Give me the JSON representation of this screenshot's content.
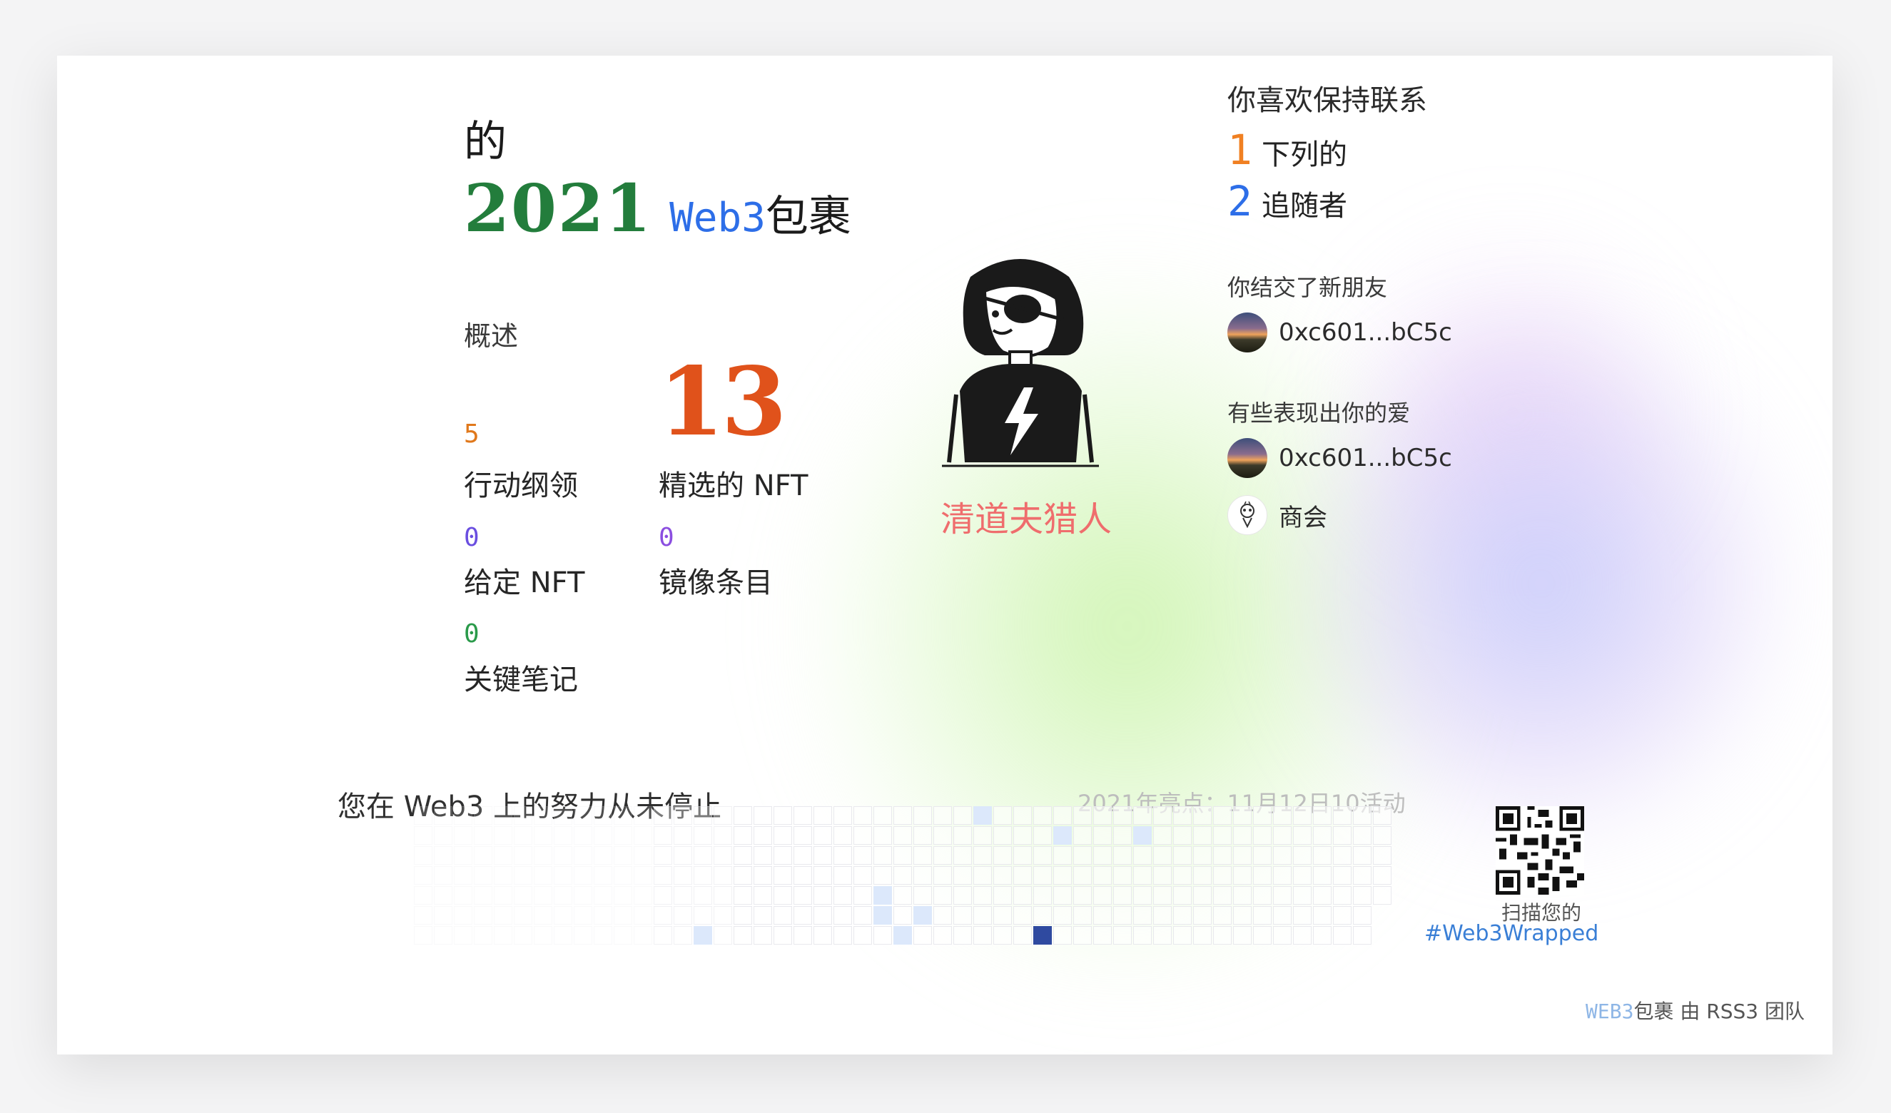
{
  "header": {
    "title_prefix": "的",
    "year": "2021",
    "web3": "Web3",
    "wrapped": "包裹"
  },
  "overview": {
    "label": "概述",
    "featured": {
      "value": "13",
      "label": "精选的 NFT",
      "color": "#e0521b"
    },
    "stats": [
      {
        "value": "5",
        "label": "行动纲领",
        "color": "#e0781b"
      },
      {
        "value": "0",
        "label": "给定 NFT",
        "color": "#6a4ee0"
      },
      {
        "value": "0",
        "label": "镜像条目",
        "color": "#8b4ee0"
      },
      {
        "value": "0",
        "label": "关键笔记",
        "color": "#2a9a4a"
      }
    ]
  },
  "profile": {
    "name": "清道夫猎人",
    "avatar_icon": "eyepatch-girl-avatar"
  },
  "connections": {
    "title": "你喜欢保持联系",
    "following": {
      "value": "1",
      "label": "下列的",
      "color": "#f08022"
    },
    "followers": {
      "value": "2",
      "label": "追随者",
      "color": "#2d6ee8"
    },
    "new_friends_label": "你结交了新朋友",
    "new_friends": [
      {
        "name": "0xc601...bC5c",
        "avatar": "sunset"
      }
    ],
    "loved_label": "有些表现出你的爱",
    "loved": [
      {
        "name": "0xc601...bC5c",
        "avatar": "sunset"
      },
      {
        "name": "商会",
        "avatar": "chamber"
      }
    ]
  },
  "activity": {
    "headline": "您在 Web3 上的努力从未停止",
    "highlight": "2021年亮点：11月12日10活动",
    "highlighted_cells": [
      {
        "col": 28,
        "row": 0,
        "level": 1
      },
      {
        "col": 32,
        "row": 1,
        "level": 1
      },
      {
        "col": 36,
        "row": 1,
        "level": 1
      },
      {
        "col": 23,
        "row": 4,
        "level": 1
      },
      {
        "col": 23,
        "row": 5,
        "level": 1
      },
      {
        "col": 25,
        "row": 5,
        "level": 1
      },
      {
        "col": 14,
        "row": 6,
        "level": 1
      },
      {
        "col": 24,
        "row": 6,
        "level": 1
      },
      {
        "col": 31,
        "row": 6,
        "level": 3
      }
    ],
    "level_colors": [
      "#ffffff",
      "#dce8fb",
      "#9fb8e8",
      "#2f4aa0"
    ]
  },
  "share": {
    "scan_text": "扫描您的",
    "hashtag": "#Web3Wrapped"
  },
  "footer": {
    "brand": "WEB3",
    "wrapped": "包裹 由 RSS3 团队"
  }
}
